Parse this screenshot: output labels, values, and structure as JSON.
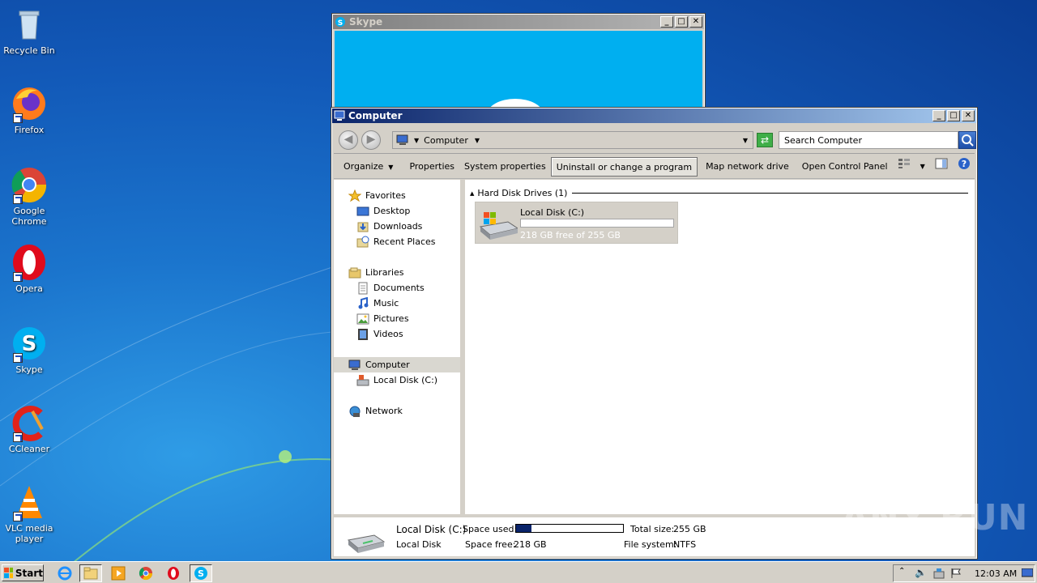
{
  "desktop": {
    "icons": [
      {
        "label": "Recycle Bin",
        "icon": "recycle-bin-icon"
      },
      {
        "label": "Firefox",
        "icon": "firefox-icon"
      },
      {
        "label": "Google Chrome",
        "icon": "chrome-icon"
      },
      {
        "label": "Opera",
        "icon": "opera-icon"
      },
      {
        "label": "Skype",
        "icon": "skype-icon"
      },
      {
        "label": "CCleaner",
        "icon": "ccleaner-icon"
      },
      {
        "label": "VLC media player",
        "icon": "vlc-icon"
      }
    ],
    "watermark": "ANY RUN"
  },
  "skype_window": {
    "title": "Skype",
    "bg_color": "#00aff0"
  },
  "explorer": {
    "title": "Computer",
    "address": "Computer",
    "search_placeholder": "Search Computer",
    "toolbar": {
      "organize": "Organize",
      "properties": "Properties",
      "system_properties": "System properties",
      "uninstall": "Uninstall or change a program",
      "map_drive": "Map network drive",
      "control_panel": "Open Control Panel"
    },
    "nav": {
      "favorites": "Favorites",
      "desktop": "Desktop",
      "downloads": "Downloads",
      "recent": "Recent Places",
      "libraries": "Libraries",
      "documents": "Documents",
      "music": "Music",
      "pictures": "Pictures",
      "videos": "Videos",
      "computer": "Computer",
      "local_disk": "Local Disk (C:)",
      "network": "Network"
    },
    "group_header": "Hard Disk Drives (1)",
    "drive": {
      "name": "Local Disk (C:)",
      "free_text": "218 GB free of 255 GB",
      "used_fraction": 0.145,
      "bar_color": "#ffffff"
    },
    "details": {
      "name": "Local Disk (C:)",
      "type": "Local Disk",
      "space_used_label": "Space used:",
      "space_free_label": "Space free:",
      "space_free_value": "218 GB",
      "total_size_label": "Total size:",
      "total_size_value": "255 GB",
      "file_system_label": "File system:",
      "file_system_value": "NTFS",
      "used_fraction": 0.145,
      "used_color": "#0a246a"
    }
  },
  "taskbar": {
    "start_label": "Start",
    "apps": [
      "internet-explorer-icon",
      "explorer-icon",
      "media-player-icon",
      "chrome-icon",
      "opera-icon",
      "skype-icon"
    ],
    "clock": "12:03 AM"
  }
}
